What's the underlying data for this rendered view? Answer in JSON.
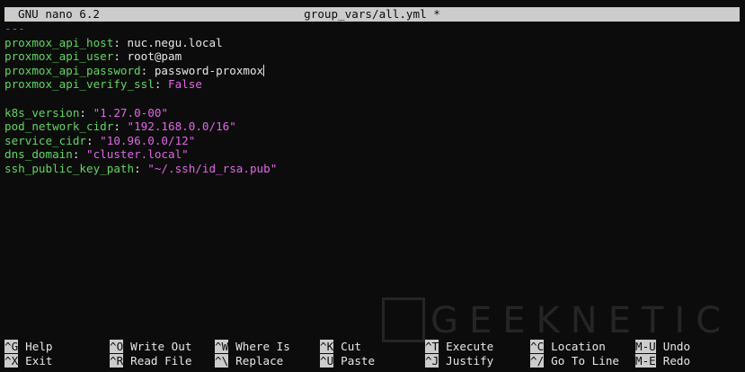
{
  "titlebar": {
    "program": "GNU nano 6.2",
    "filename": "group_vars/all.yml *"
  },
  "editor": {
    "lines": [
      {
        "key": "---"
      },
      {
        "key": "proxmox_api_host",
        "sep": ": ",
        "value": "nuc.negu.local"
      },
      {
        "key": "proxmox_api_user",
        "sep": ": ",
        "value": "root@pam"
      },
      {
        "key": "proxmox_api_password",
        "sep": ": ",
        "value": "password-proxmox"
      },
      {
        "key": "proxmox_api_verify_ssl",
        "sep": ": ",
        "value": "False"
      },
      {
        "key": ""
      },
      {
        "key": "k8s_version",
        "sep": ": ",
        "value": "\"1.27.0-00\""
      },
      {
        "key": "pod_network_cidr",
        "sep": ": ",
        "value": "\"192.168.0.0/16\""
      },
      {
        "key": "service_cidr",
        "sep": ": ",
        "value": "\"10.96.0.0/12\""
      },
      {
        "key": "dns_domain",
        "sep": ": ",
        "value": "\"cluster.local\""
      },
      {
        "key": "ssh_public_key_path",
        "sep": ": ",
        "value": "\"~/.ssh/id_rsa.pub\""
      }
    ]
  },
  "shortcuts": {
    "row1": [
      {
        "key": "^G",
        "label": "Help"
      },
      {
        "key": "^O",
        "label": "Write Out"
      },
      {
        "key": "^W",
        "label": "Where Is"
      },
      {
        "key": "^K",
        "label": "Cut"
      },
      {
        "key": "^T",
        "label": "Execute"
      },
      {
        "key": "^C",
        "label": "Location"
      },
      {
        "key": "M-U",
        "label": "Undo"
      }
    ],
    "row2": [
      {
        "key": "^X",
        "label": "Exit"
      },
      {
        "key": "^R",
        "label": "Read File"
      },
      {
        "key": "^\\",
        "label": "Replace"
      },
      {
        "key": "^U",
        "label": "Paste"
      },
      {
        "key": "^J",
        "label": "Justify"
      },
      {
        "key": "^/",
        "label": "Go To Line"
      },
      {
        "key": "M-E",
        "label": "Redo"
      }
    ]
  },
  "watermark": {
    "text": "GEEKNETIC"
  },
  "colors": {
    "key": "#5fd75f",
    "string": "#e066e6",
    "bar": "#cccccc",
    "background": "#0c0c0c"
  }
}
